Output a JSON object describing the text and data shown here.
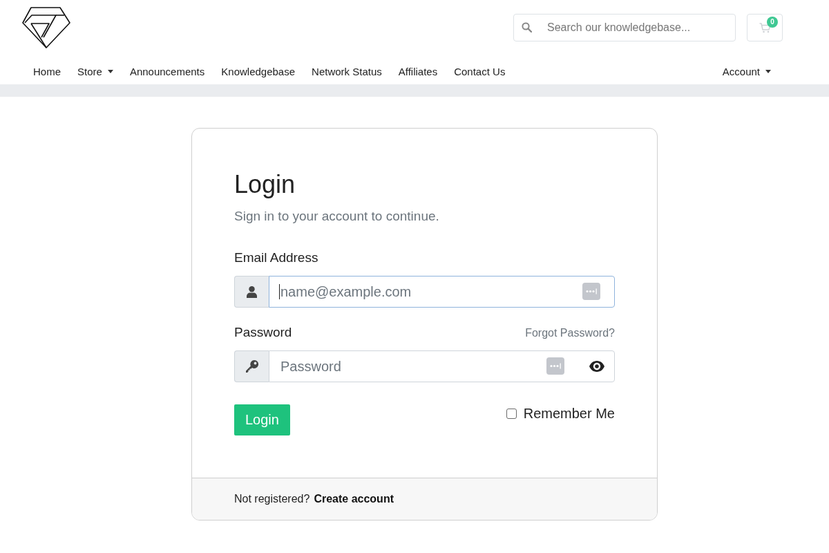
{
  "header": {
    "search": {
      "placeholder": "Search our knowledgebase..."
    },
    "cart": {
      "count": "0"
    }
  },
  "nav": {
    "items": [
      {
        "label": "Home",
        "dropdown": false
      },
      {
        "label": "Store",
        "dropdown": true
      },
      {
        "label": "Announcements",
        "dropdown": false
      },
      {
        "label": "Knowledgebase",
        "dropdown": false
      },
      {
        "label": "Network Status",
        "dropdown": false
      },
      {
        "label": "Affiliates",
        "dropdown": false
      },
      {
        "label": "Contact Us",
        "dropdown": false
      }
    ],
    "account": {
      "label": "Account",
      "dropdown": true
    }
  },
  "login": {
    "title": "Login",
    "subtitle": "Sign in to your account to continue.",
    "fields": [
      {
        "kind": "email",
        "label": "Email Address",
        "placeholder": "name@example.com",
        "focused": true
      },
      {
        "kind": "password",
        "label": "Password",
        "link": "Forgot Password?",
        "placeholder": "Password",
        "focused": false
      }
    ],
    "button": "Login",
    "remember": {
      "label": "Remember Me",
      "checked": false
    },
    "footer": {
      "text": "Not registered?",
      "link": "Create account"
    }
  }
}
